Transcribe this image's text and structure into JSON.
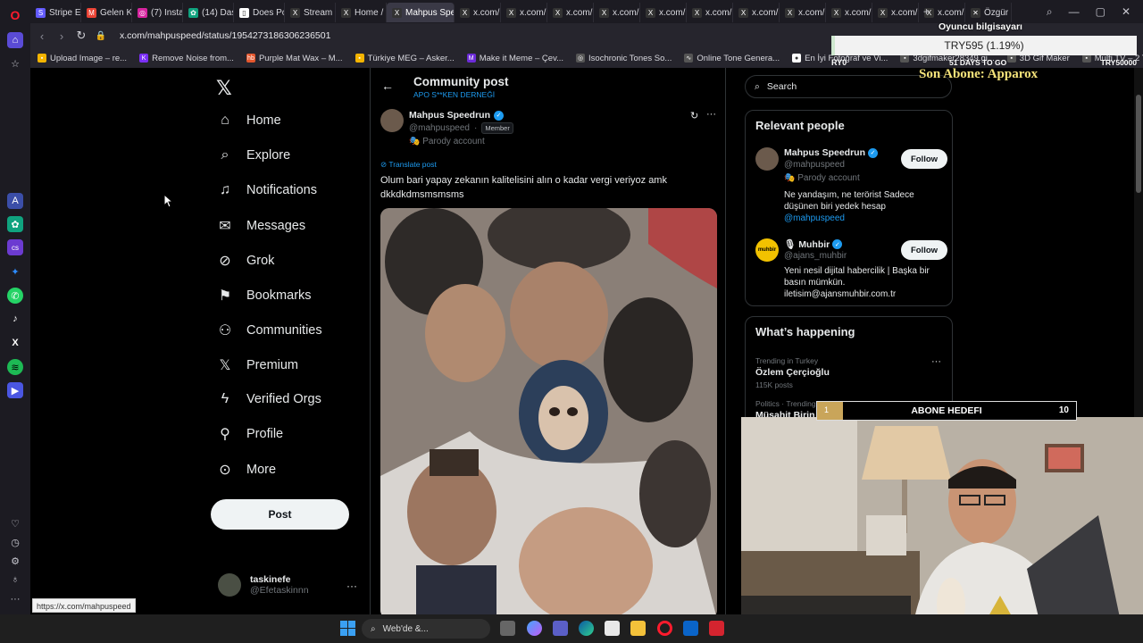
{
  "tabs": [
    {
      "label": "Stripe Ex",
      "color": "#635bff",
      "glyph": "S"
    },
    {
      "label": "Gelen Ku",
      "color": "#ea4335",
      "glyph": "M"
    },
    {
      "label": "(7) Instag",
      "color": "#d6249f",
      "glyph": "◎"
    },
    {
      "label": "(14) Dash",
      "color": "#10a37f",
      "glyph": "✿"
    },
    {
      "label": "Does Po",
      "color": "#ffffff",
      "glyph": "▯"
    },
    {
      "label": "Stream",
      "color": "#333333",
      "glyph": "X"
    },
    {
      "label": "Home / X",
      "color": "#333333",
      "glyph": "X"
    },
    {
      "label": "Mahpus Speedr",
      "color": "#333333",
      "glyph": "X",
      "active": true
    },
    {
      "label": "x.com/O",
      "color": "#333333",
      "glyph": "X"
    },
    {
      "label": "x.com/b",
      "color": "#333333",
      "glyph": "X"
    },
    {
      "label": "x.com/b",
      "color": "#333333",
      "glyph": "X"
    },
    {
      "label": "x.com/C",
      "color": "#333333",
      "glyph": "X"
    },
    {
      "label": "x.com/b",
      "color": "#333333",
      "glyph": "X"
    },
    {
      "label": "x.com/a",
      "color": "#333333",
      "glyph": "X"
    },
    {
      "label": "x.com/g",
      "color": "#333333",
      "glyph": "X"
    },
    {
      "label": "x.com/n",
      "color": "#333333",
      "glyph": "X"
    },
    {
      "label": "x.com/p",
      "color": "#333333",
      "glyph": "X"
    },
    {
      "label": "x.com/a",
      "color": "#333333",
      "glyph": "X"
    },
    {
      "label": "x.com/X",
      "color": "#333333",
      "glyph": "X"
    },
    {
      "label": "Özgür O",
      "color": "#333333",
      "glyph": "✕"
    }
  ],
  "address": {
    "url": "x.com/mahpuspeed/status/1954273186306236501"
  },
  "bookmarks": [
    {
      "label": "Upload Image – re...",
      "color": "#f4b400",
      "glyph": "▪"
    },
    {
      "label": "Remove Noise from...",
      "color": "#7b2ff7",
      "glyph": "K"
    },
    {
      "label": "Purple Mat Wax – M...",
      "color": "#e4572e",
      "glyph": "hb"
    },
    {
      "label": "Türkiye MEG – Asker...",
      "color": "#f4b400",
      "glyph": "▪"
    },
    {
      "label": "Make it Meme – Çev...",
      "color": "#6c2bd9",
      "glyph": "M"
    },
    {
      "label": "Isochronic Tones So...",
      "color": "#555555",
      "glyph": "◎"
    },
    {
      "label": "Online Tone Genera...",
      "color": "#555555",
      "glyph": "∿"
    },
    {
      "label": "En İyi Fotoğraf ve Vi...",
      "color": "#ffffff",
      "glyph": "●"
    },
    {
      "label": "3dgifmaker28349.gi...",
      "color": "#555555",
      "glyph": "▪"
    },
    {
      "label": "3D Gif Maker",
      "color": "#555555",
      "glyph": "▪"
    },
    {
      "label": "Multi TV – 2 Tuber",
      "color": "#555555",
      "glyph": "▪"
    }
  ],
  "xnav": {
    "logo": "𝕏",
    "items": [
      {
        "key": "home",
        "label": "Home",
        "glyph": "⌂"
      },
      {
        "key": "explore",
        "label": "Explore",
        "glyph": "⌕"
      },
      {
        "key": "notifications",
        "label": "Notifications",
        "glyph": "♫"
      },
      {
        "key": "messages",
        "label": "Messages",
        "glyph": "✉"
      },
      {
        "key": "grok",
        "label": "Grok",
        "glyph": "⊘"
      },
      {
        "key": "bookmarks",
        "label": "Bookmarks",
        "glyph": "⚑"
      },
      {
        "key": "communities",
        "label": "Communities",
        "glyph": "⚇"
      },
      {
        "key": "premium",
        "label": "Premium",
        "glyph": "𝕏"
      },
      {
        "key": "verified-orgs",
        "label": "Verified Orgs",
        "glyph": "ϟ"
      },
      {
        "key": "profile",
        "label": "Profile",
        "glyph": "⚲"
      },
      {
        "key": "more",
        "label": "More",
        "glyph": "⊙"
      }
    ],
    "post_label": "Post",
    "account_name": "taskinefe",
    "account_handle": "@Efetaskinnn",
    "account_more": "···"
  },
  "post": {
    "header_title": "Community post",
    "header_sub": "APO S**KEN DERNEĞİ",
    "author_name": "Mahpus Speedrun",
    "author_handle": "@mahpuspeed",
    "handle_sep": "·",
    "member_badge": "Member",
    "parody_label": "🎭 Parody account",
    "translate_label": "⊘ Translate post",
    "text": "Olum bari yapay zekanın kalitelisini alın o kadar vergi veriyoz amk dkkdkdmsmsmsms",
    "more": "···",
    "grok": "↻",
    "back": "←"
  },
  "search": {
    "placeholder": "Search",
    "icon": "⌕"
  },
  "relevant": {
    "title": "Relevant people",
    "people": [
      {
        "name": "Mahpus Speedrun",
        "handle": "@mahpuspeed",
        "extra": "🎭 Parody account",
        "bio": "Ne yandaşım, ne terörist Sadece düşünen biri yedek hesap",
        "bio_link": "@mahpuspeed",
        "follow": "Follow",
        "avatar_color": "#6b5a4c"
      },
      {
        "name": "🎙 Muhbir",
        "handle": "@ajans_muhbir",
        "extra": "",
        "bio": "Yeni nesil dijital habercilik | Başka bir basın mümkün. iletisim@ajansmuhbir.com.tr",
        "bio_link": "",
        "follow": "Follow",
        "avatar_color": "#f2c200",
        "avatar_text": "muhbir"
      }
    ]
  },
  "happening": {
    "title": "What’s happening",
    "trends": [
      {
        "context": "Trending in Turkey",
        "name": "Özlem Çerçioğlu",
        "count": "115K posts"
      },
      {
        "context": "Politics · Trending",
        "name": "Müsahit Birin",
        "count": ""
      }
    ],
    "more": "···"
  },
  "stream": {
    "label": "Oyuncu bilgisayarı",
    "value": "TRY595 (1.19%)",
    "left": "RY0",
    "mid": "51 DAYS TO GO",
    "right": "TRY50000",
    "progress": 0.0119,
    "son_abone": "Son Abone: Apparox",
    "abone_current": "1",
    "abone_title": "ABONE HEDEFI",
    "abone_goal": "10",
    "abone_progress": 0.1
  },
  "status_url": "https://x.com/mahpuspeed",
  "taskbar": {
    "search": "Web'de &..."
  }
}
